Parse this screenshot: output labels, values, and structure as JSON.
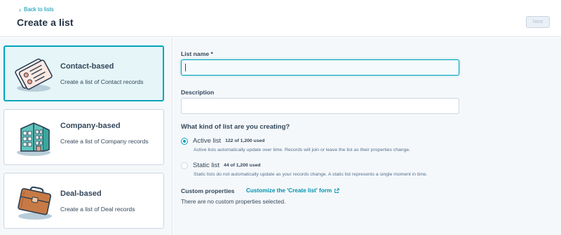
{
  "header": {
    "back_label": "Back to lists",
    "title": "Create a list",
    "next_label": "Next"
  },
  "cards": [
    {
      "title": "Contact-based",
      "desc": "Create a list of Contact records",
      "selected": true,
      "icon": "contact-cards-icon"
    },
    {
      "title": "Company-based",
      "desc": "Create a list of Company records",
      "selected": false,
      "icon": "building-icon"
    },
    {
      "title": "Deal-based",
      "desc": "Create a list of Deal records",
      "selected": false,
      "icon": "briefcase-icon"
    }
  ],
  "form": {
    "list_name_label": "List name *",
    "list_name_value": "",
    "description_label": "Description",
    "description_value": "",
    "question": "What kind of list are you creating?",
    "options": [
      {
        "label": "Active list",
        "usage": "122 of 1,200 used",
        "help": "Active lists automatically update over time. Records will join or leave the list as their properties change.",
        "checked": true
      },
      {
        "label": "Static list",
        "usage": "44 of 1,200 used",
        "help": "Static lists do not automatically update as your records change. A static list represents a single moment in time.",
        "checked": false
      }
    ],
    "custom_title": "Custom properties",
    "custom_link": "Customize the 'Create list' form",
    "custom_empty": "There are no custom properties selected."
  },
  "colors": {
    "accent": "#00a4bd",
    "link": "#0091ae",
    "text": "#33475b",
    "panel": "#f5f8fa",
    "selected_card": "#e5f5f8"
  }
}
